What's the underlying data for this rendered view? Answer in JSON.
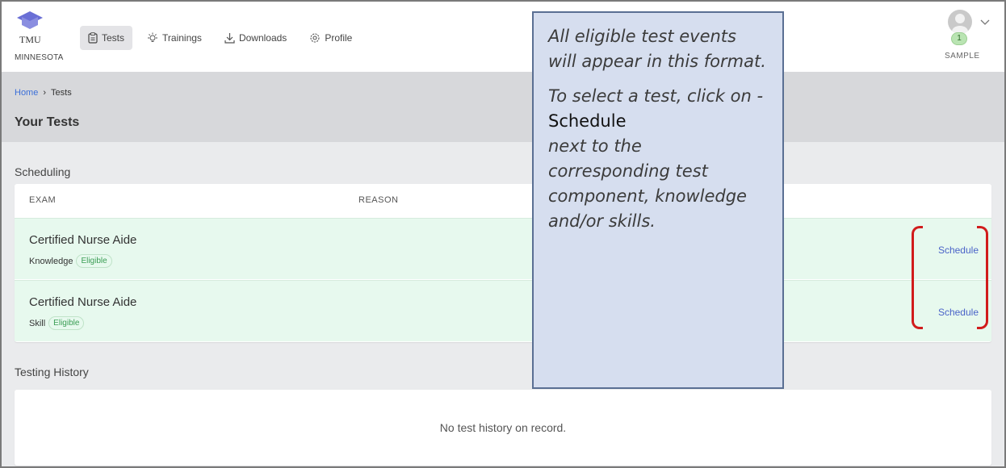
{
  "brand": {
    "name": "TMU",
    "state": "MINNESOTA",
    "accent": "#6a6fd6"
  },
  "nav": [
    {
      "label": "Tests",
      "icon": "clipboard-icon",
      "active": true
    },
    {
      "label": "Trainings",
      "icon": "lightbulb-icon",
      "active": false
    },
    {
      "label": "Downloads",
      "icon": "download-icon",
      "active": false
    },
    {
      "label": "Profile",
      "icon": "gear-icon",
      "active": false
    }
  ],
  "user": {
    "badge": "1",
    "name": "SAMPLE"
  },
  "breadcrumb": {
    "home": "Home",
    "separator": "›",
    "current": "Tests"
  },
  "page_title": "Your Tests",
  "scheduling": {
    "label": "Scheduling",
    "columns": [
      "EXAM",
      "REASON"
    ],
    "rows": [
      {
        "exam": "Certified Nurse Aide",
        "component": "Knowledge",
        "status": "Eligible",
        "action": "Schedule"
      },
      {
        "exam": "Certified Nurse Aide",
        "component": "Skill",
        "status": "Eligible",
        "action": "Schedule"
      }
    ]
  },
  "history": {
    "label": "Testing History",
    "empty": "No test history on record."
  },
  "callout": {
    "line1": "All eligible test events will appear in this format.",
    "line2": "To select a test, click on -",
    "keyword": "Schedule",
    "line3": "next to the corresponding test component, knowledge and/or skills."
  },
  "colors": {
    "eligible_row": "#e7f9ee",
    "link": "#4a63c8",
    "annotation": "#d11c1c",
    "callout_bg": "#d6deef"
  }
}
